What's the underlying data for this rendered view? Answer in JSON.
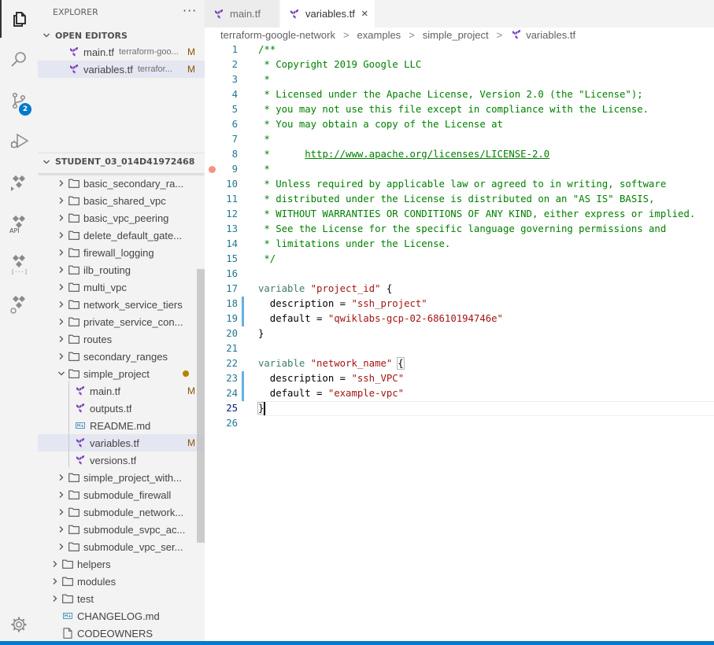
{
  "activity_bar": {
    "items": [
      {
        "name": "explorer-icon",
        "active": true
      },
      {
        "name": "search-icon"
      },
      {
        "name": "source-control-icon",
        "badge": "2"
      },
      {
        "name": "run-debug-icon"
      },
      {
        "name": "cloud-code-icon"
      },
      {
        "name": "cloud-api-icon",
        "label": "API"
      },
      {
        "name": "cloud-code-brackets-icon"
      },
      {
        "name": "cloud-code-settings-icon"
      }
    ],
    "manage": "gear-icon"
  },
  "sidebar": {
    "title": "EXPLORER",
    "more": "···",
    "open_editors": {
      "title": "OPEN EDITORS",
      "items": [
        {
          "name": "main.tf",
          "desc": "terraform-goo...",
          "status": "M"
        },
        {
          "name": "variables.tf",
          "desc": "terrafor...",
          "status": "M"
        }
      ]
    },
    "workspace": {
      "title": "STUDENT_03_014D41972468",
      "folders": [
        "basic_secondary_ra...",
        "basic_shared_vpc",
        "basic_vpc_peering",
        "delete_default_gate...",
        "firewall_logging",
        "ilb_routing",
        "multi_vpc",
        "network_service_tiers",
        "private_service_con...",
        "routes",
        "secondary_ranges",
        "simple_project"
      ],
      "simple_project_files": [
        {
          "name": "main.tf",
          "status": "M"
        },
        {
          "name": "outputs.tf",
          "status": ""
        },
        {
          "name": "README.md",
          "status": ""
        },
        {
          "name": "variables.tf",
          "status": "M"
        },
        {
          "name": "versions.tf",
          "status": ""
        }
      ],
      "folders_after": [
        "simple_project_with...",
        "submodule_firewall",
        "submodule_network...",
        "submodule_svpc_ac...",
        "submodule_vpc_ser..."
      ],
      "root_folders": [
        "helpers",
        "modules",
        "test"
      ],
      "root_files": [
        "CHANGELOG.md",
        "CODEOWNERS"
      ]
    }
  },
  "tabs": [
    {
      "label": "main.tf",
      "active": false
    },
    {
      "label": "variables.tf",
      "active": true,
      "close": "×"
    }
  ],
  "breadcrumb": [
    "terraform-google-network",
    "examples",
    "simple_project",
    "variables.tf"
  ],
  "breadcrumb_sep": ">",
  "editor": {
    "line_numbers": [
      "1",
      "2",
      "3",
      "4",
      "5",
      "6",
      "7",
      "8",
      "9",
      "10",
      "11",
      "12",
      "13",
      "14",
      "15",
      "16",
      "17",
      "18",
      "19",
      "20",
      "21",
      "22",
      "23",
      "24",
      "25",
      "26"
    ],
    "comment_lines": [
      "/**",
      " * Copyright 2019 Google LLC",
      " *",
      " * Licensed under the Apache License, Version 2.0 (the \"License\");",
      " * you may not use this file except in compliance with the License.",
      " * You may obtain a copy of the License at",
      " *",
      " *      ",
      " *",
      " * Unless required by applicable law or agreed to in writing, software",
      " * distributed under the License is distributed on an \"AS IS\" BASIS,",
      " * WITHOUT WARRANTIES OR CONDITIONS OF ANY KIND, either express or implied.",
      " * See the License for the specific language governing permissions and",
      " * limitations under the License.",
      " */"
    ],
    "license_url": "http://www.apache.org/licenses/LICENSE-2.0",
    "var1": {
      "keyword": "variable",
      "name": "\"project_id\"",
      "open": " {",
      "desc_key": "  description = ",
      "desc_val": "\"ssh_project\"",
      "def_key": "  default = ",
      "def_val": "\"qwiklabs-gcp-02-68610194746e\"",
      "close": "}"
    },
    "var2": {
      "keyword": "variable",
      "name": "\"network_name\"",
      "open": "{",
      "desc_key": "  description = ",
      "desc_val": "\"ssh_VPC\"",
      "def_key": "  default = ",
      "def_val": "\"example-vpc\"",
      "close": "}"
    }
  }
}
